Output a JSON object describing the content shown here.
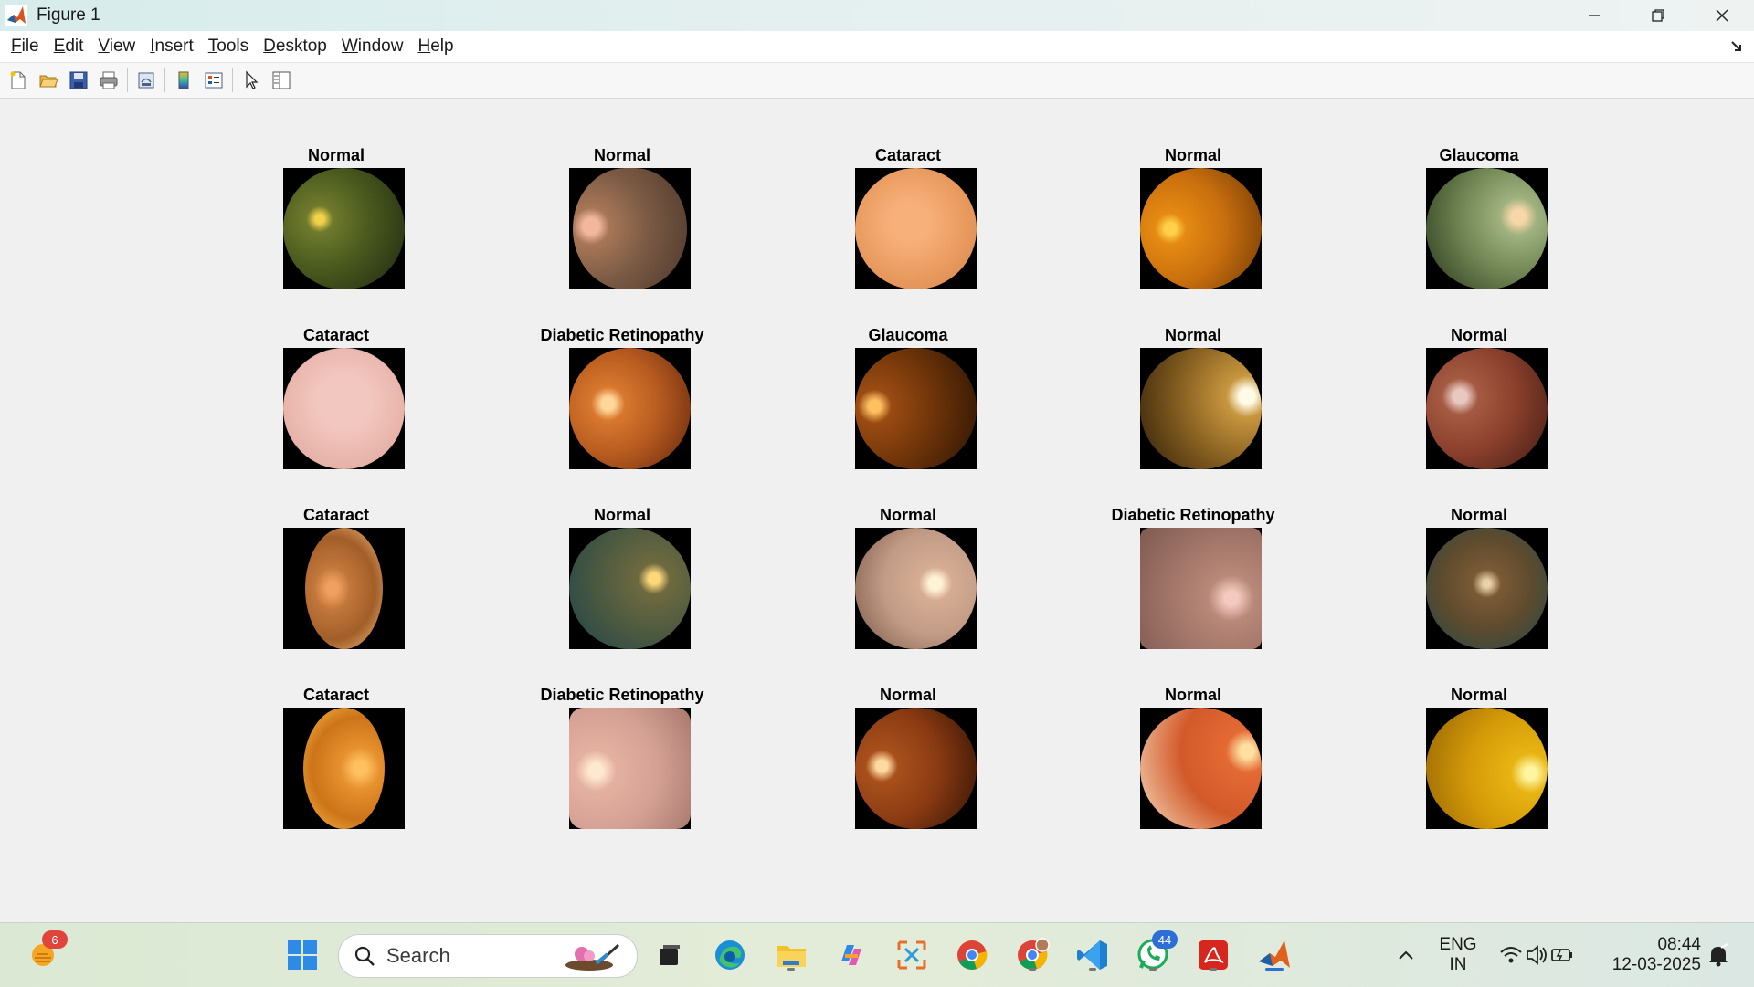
{
  "window": {
    "title": "Figure 1"
  },
  "menu": [
    {
      "u": "F",
      "rest": "ile"
    },
    {
      "u": "E",
      "rest": "dit"
    },
    {
      "u": "V",
      "rest": "iew"
    },
    {
      "u": "I",
      "rest": "nsert"
    },
    {
      "u": "T",
      "rest": "ools"
    },
    {
      "u": "D",
      "rest": "esktop"
    },
    {
      "u": "W",
      "rest": "indow"
    },
    {
      "u": "H",
      "rest": "elp"
    }
  ],
  "figure": {
    "rows": [
      [
        "Normal",
        "Normal",
        "Cataract",
        "Normal",
        "Glaucoma"
      ],
      [
        "Cataract",
        "Diabetic Retinopathy",
        "Glaucoma",
        "Normal",
        "Normal"
      ],
      [
        "Cataract",
        "Normal",
        "Normal",
        "Diabetic Retinopathy",
        "Normal"
      ],
      [
        "Cataract",
        "Diabetic Retinopathy",
        "Normal",
        "Normal",
        "Normal"
      ]
    ]
  },
  "taskbar": {
    "search_placeholder": "Search",
    "weather_badge": "6",
    "whatsapp_badge": "44",
    "language": "ENG",
    "region": "IN",
    "time": "08:44",
    "date": "12-03-2025"
  }
}
